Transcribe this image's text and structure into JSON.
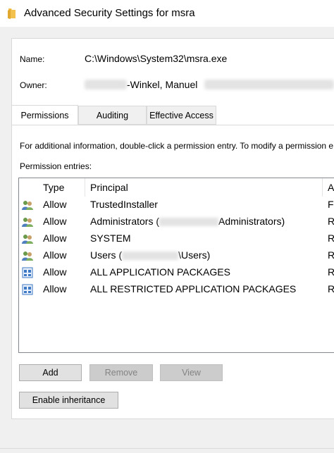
{
  "window": {
    "title": "Advanced Security Settings for msra"
  },
  "info": {
    "name_label": "Name:",
    "name_value": "C:\\Windows\\System32\\msra.exe",
    "owner_label": "Owner:",
    "owner_value": "-Winkel, Manuel"
  },
  "tabs": [
    {
      "label": "Permissions",
      "active": true
    },
    {
      "label": "Auditing",
      "active": false
    },
    {
      "label": "Effective Access",
      "active": false
    }
  ],
  "panel": {
    "instructions": "For additional information, double-click a permission entry. To modify a permission e",
    "entries_label": "Permission entries:"
  },
  "table": {
    "columns": [
      "Type",
      "Principal",
      "A"
    ],
    "rows": [
      {
        "icon": "users-icon",
        "type": "Allow",
        "principal": "TrustedInstaller",
        "access": "Fu"
      },
      {
        "icon": "users-icon",
        "type": "Allow",
        "principal_pre": "Administrators (",
        "principal_post": "Administrators)",
        "access": "R"
      },
      {
        "icon": "users-icon",
        "type": "Allow",
        "principal": "SYSTEM",
        "access": "R"
      },
      {
        "icon": "users-icon",
        "type": "Allow",
        "principal_pre": "Users (",
        "principal_post": "\\Users)",
        "access": "R"
      },
      {
        "icon": "app-packages-icon",
        "type": "Allow",
        "principal": "ALL APPLICATION PACKAGES",
        "access": "R"
      },
      {
        "icon": "app-packages-icon",
        "type": "Allow",
        "principal": "ALL RESTRICTED APPLICATION PACKAGES",
        "access": "R"
      }
    ]
  },
  "buttons": {
    "add": "Add",
    "remove": "Remove",
    "view": "View",
    "enable_inheritance": "Enable inheritance"
  }
}
